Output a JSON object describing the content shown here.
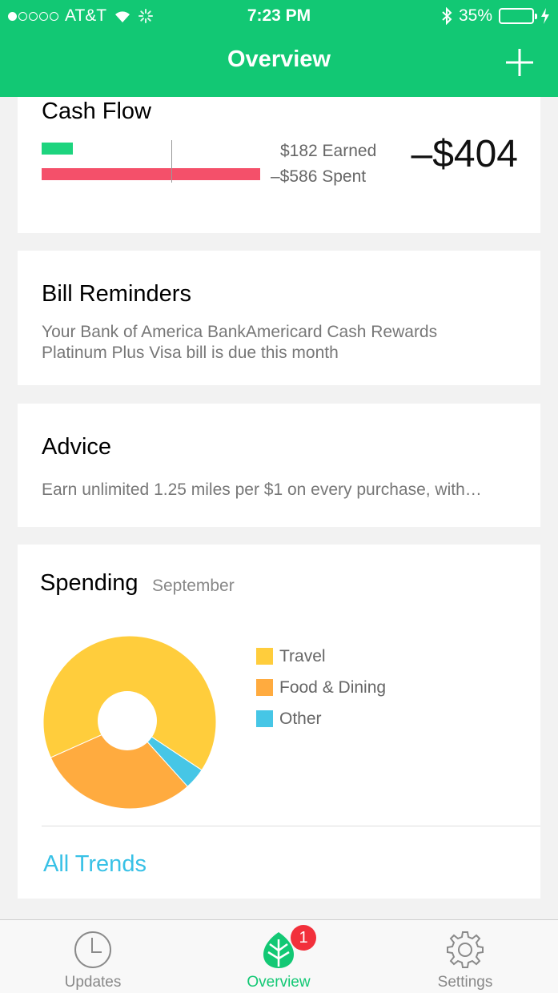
{
  "status_bar": {
    "carrier": "AT&T",
    "time": "7:23 PM",
    "battery": "35%",
    "battery_level": 0.35
  },
  "header": {
    "title": "Overview",
    "add_icon": "plus-icon"
  },
  "cash_flow": {
    "title": "Cash Flow",
    "earned_label": "$182 Earned",
    "spent_label": "–$586 Spent",
    "net": "–$404",
    "earned_value": 182,
    "spent_value": 586,
    "earned_color": "#1dd47e",
    "spent_color": "#f4506a"
  },
  "bill_reminders": {
    "title": "Bill Reminders",
    "body": "Your Bank of America BankAmericard Cash Rewards Platinum Plus Visa bill is due this month"
  },
  "advice": {
    "title": "Advice",
    "body": "Earn unlimited 1.25 miles per $1 on every purchase, with…"
  },
  "spending": {
    "title": "Spending",
    "month": "September",
    "all_trends": "All Trends",
    "chart_data": {
      "type": "pie",
      "categories": [
        "Travel",
        "Food & Dining",
        "Other"
      ],
      "values": [
        66,
        30,
        4
      ],
      "colors": [
        "#ffcd3c",
        "#ffab3f",
        "#46c6e6"
      ]
    }
  },
  "tabs": [
    {
      "label": "Updates",
      "icon": "clock-icon",
      "active": false
    },
    {
      "label": "Overview",
      "icon": "leaf-icon",
      "active": true,
      "badge": "1"
    },
    {
      "label": "Settings",
      "icon": "gear-icon",
      "active": false
    }
  ]
}
